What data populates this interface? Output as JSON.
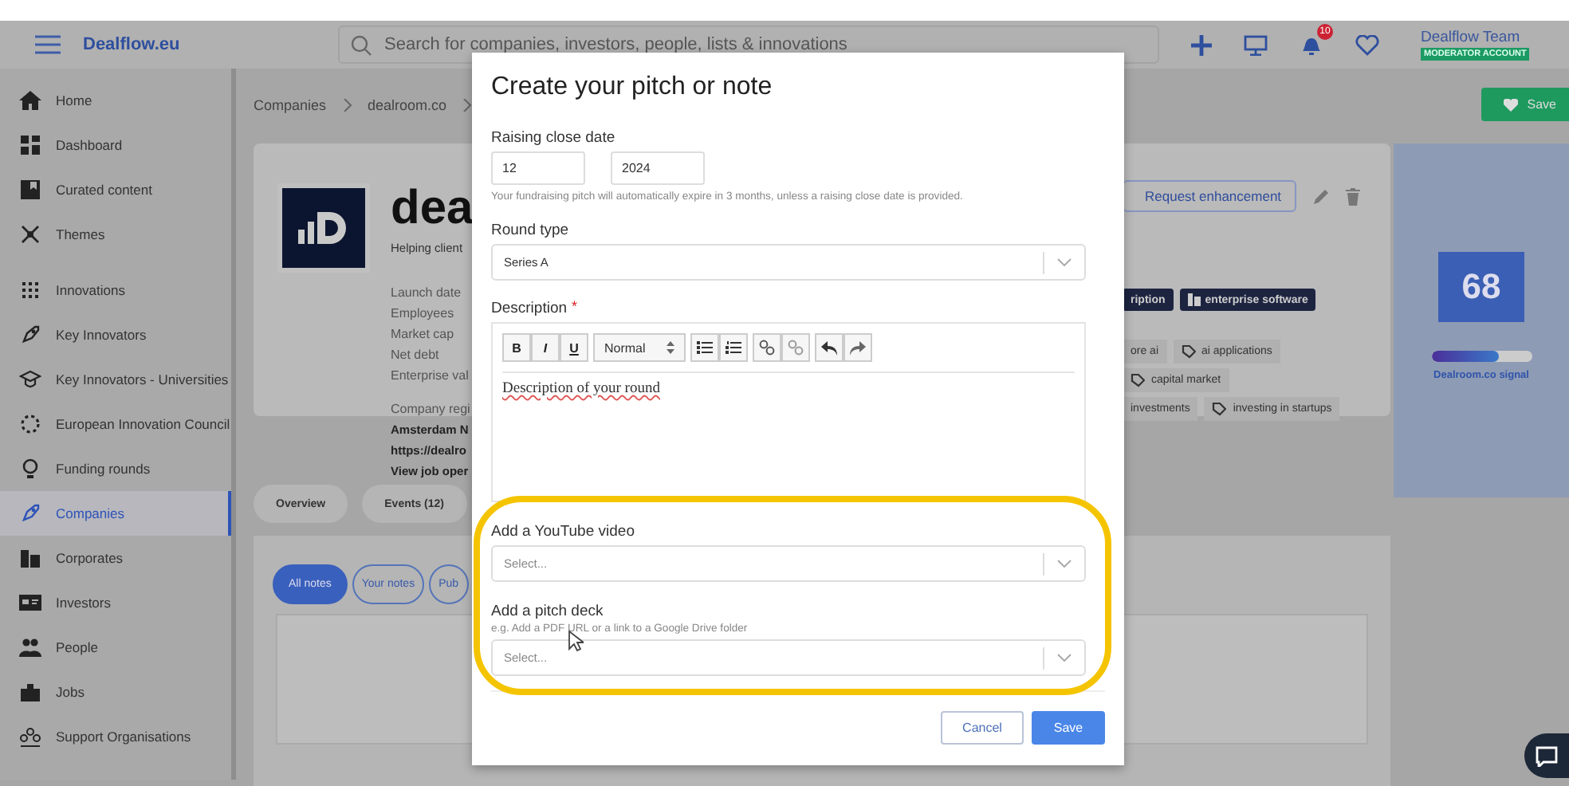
{
  "header": {
    "brand": "Dealflow.eu",
    "search": {
      "placeholder": "Search for companies, investors, people, lists & innovations"
    },
    "notification_count": "10",
    "user": {
      "name": "Dealflow Team",
      "role": "MODERATOR ACCOUNT"
    }
  },
  "sidebar": {
    "sections": [
      [
        {
          "label": "Home",
          "selected": false
        },
        {
          "label": "Dashboard",
          "selected": false
        },
        {
          "label": "Curated content",
          "selected": false
        },
        {
          "label": "Themes",
          "selected": false
        }
      ],
      [
        {
          "label": "Innovations",
          "selected": false
        },
        {
          "label": "Key Innovators",
          "selected": false
        },
        {
          "label": "Key Innovators - Universities",
          "selected": false
        },
        {
          "label": "European Innovation Council",
          "selected": false
        },
        {
          "label": "Funding rounds",
          "selected": false
        },
        {
          "label": "Companies",
          "selected": true
        },
        {
          "label": "Corporates",
          "selected": false
        },
        {
          "label": "Investors",
          "selected": false
        },
        {
          "label": "People",
          "selected": false
        },
        {
          "label": "Jobs",
          "selected": false
        },
        {
          "label": "Support Organisations",
          "selected": false
        }
      ]
    ]
  },
  "breadcrumb": [
    "Companies",
    "dealroom.co"
  ],
  "save_button": "Save",
  "company": {
    "name": "dea",
    "tagline": "Helping client",
    "facts": [
      "Launch date",
      "Employees",
      "Market cap",
      "Net debt",
      "Enterprise val"
    ],
    "registry_label": "Company regi",
    "links": [
      "Amsterdam N",
      "https://dealro",
      "View job oper"
    ],
    "request_button": "Request enhancement",
    "category_tags": [
      "ription",
      "enterprise software"
    ],
    "tag_rows": [
      [
        "ore ai",
        "ai applications"
      ],
      [
        "capital market"
      ],
      [
        "investments",
        "investing in startups"
      ]
    ]
  },
  "signal": {
    "score": "68",
    "level": 0.68,
    "label": "Dealroom.co signal"
  },
  "tabs": [
    "Overview",
    "Events (12)"
  ],
  "note_filters": [
    {
      "label": "All notes",
      "selected": true
    },
    {
      "label": "Your notes",
      "selected": false
    },
    {
      "label": "Pub",
      "selected": false
    }
  ],
  "modal": {
    "title": "Create your pitch or note",
    "close_date": {
      "label": "Raising close date",
      "month": "12",
      "year": "2024",
      "hint": "Your fundraising pitch will automatically expire in 3 months, unless a raising close date is provided."
    },
    "round_type": {
      "label": "Round type",
      "value": "Series A"
    },
    "description": {
      "label": "Description",
      "required_mark": "*",
      "bold": "B",
      "italic": "I",
      "underline": "U",
      "format": "Normal",
      "text": "Description of your round"
    },
    "youtube": {
      "label": "Add a YouTube video",
      "placeholder": "Select..."
    },
    "pitch_deck": {
      "label": "Add a pitch deck",
      "hint": "e.g. Add a PDF URL or a link to a Google Drive folder",
      "placeholder": "Select..."
    },
    "buttons": [
      "Cancel",
      "Save"
    ]
  }
}
